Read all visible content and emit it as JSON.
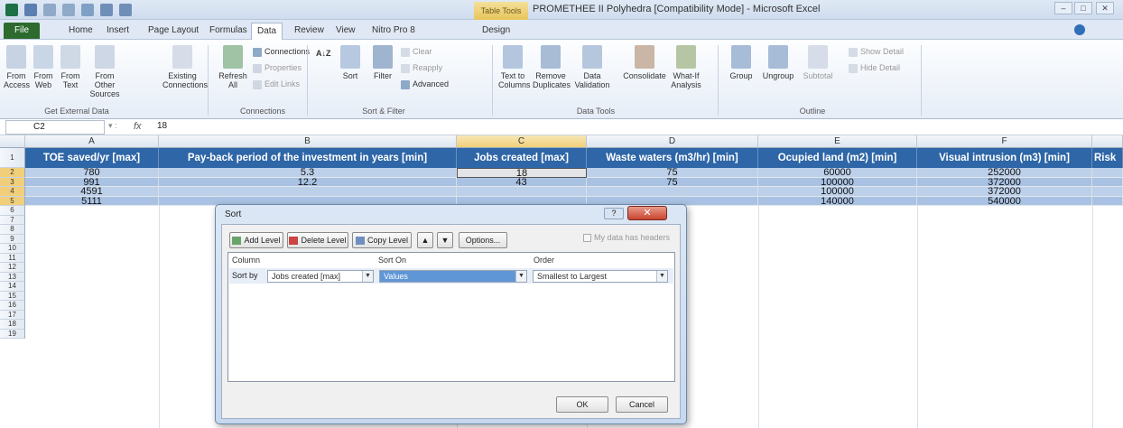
{
  "window": {
    "title": "PROMETHEE II Polyhedra [Compatibility Mode] - Microsoft Excel",
    "contextual_tab": "Table Tools",
    "controls": [
      "–",
      "□",
      "✕"
    ]
  },
  "tabs": {
    "file": "File",
    "items": [
      "Home",
      "Insert",
      "Page Layout",
      "Formulas",
      "Data",
      "Review",
      "View",
      "Nitro Pro 8",
      "Design"
    ],
    "active": "Data"
  },
  "ribbon": {
    "get_external": {
      "from_access": "From Access",
      "from_web": "From Web",
      "from_text": "From Text",
      "from_other": "From Other Sources",
      "existing": "Existing Connections",
      "label": "Get External Data"
    },
    "connections": {
      "refresh": "Refresh All",
      "connections": "Connections",
      "properties": "Properties",
      "edit_links": "Edit Links",
      "label": "Connections"
    },
    "sort_filter": {
      "sort": "Sort",
      "filter": "Filter",
      "clear": "Clear",
      "reapply": "Reapply",
      "advanced": "Advanced",
      "label": "Sort & Filter"
    },
    "data_tools": {
      "text_to_columns": "Text to Columns",
      "remove_duplicates": "Remove Duplicates",
      "data_validation": "Data Validation",
      "consolidate": "Consolidate",
      "what_if": "What-If Analysis",
      "label": "Data Tools"
    },
    "outline": {
      "group": "Group",
      "ungroup": "Ungroup",
      "subtotal": "Subtotal",
      "show_detail": "Show Detail",
      "hide_detail": "Hide Detail",
      "label": "Outline"
    }
  },
  "formula_bar": {
    "name_box": "C2",
    "fx": "fx",
    "value": "18"
  },
  "columns": [
    "A",
    "B",
    "C",
    "D",
    "E",
    "F"
  ],
  "headers": [
    "TOE saved/yr [max]",
    "Pay-back period of the investment in years [min]",
    "Jobs created [max]",
    "Waste waters (m3/hr) [min]",
    "Ocupied land (m2) [min]",
    "Visual intrusion (m3) [min]",
    "Risk"
  ],
  "rows": [
    [
      "780",
      "5.3",
      "18",
      "75",
      "60000",
      "252000"
    ],
    [
      "991",
      "12.2",
      "43",
      "75",
      "100000",
      "372000"
    ],
    [
      "4591",
      "",
      "",
      "",
      "100000",
      "372000"
    ],
    [
      "5111",
      "",
      "",
      "",
      "140000",
      "540000"
    ]
  ],
  "row_numbers": [
    "1",
    "2",
    "3",
    "4",
    "5",
    "6",
    "7",
    "8",
    "9",
    "10",
    "11",
    "12",
    "13",
    "14",
    "15",
    "16",
    "17",
    "18",
    "19"
  ],
  "sort_dialog": {
    "title": "Sort",
    "add_level": "Add Level",
    "delete_level": "Delete Level",
    "copy_level": "Copy Level",
    "up": "▲",
    "down": "▼",
    "options": "Options...",
    "my_data_has_headers": "My data has headers",
    "col_header": "Column",
    "sort_on_header": "Sort On",
    "order_header": "Order",
    "sort_by_label": "Sort by",
    "column_value": "Jobs created [max]",
    "sort_on_value": "Values",
    "order_value": "Smallest to Largest",
    "ok": "OK",
    "cancel": "Cancel",
    "help": "?",
    "close": "✕"
  }
}
